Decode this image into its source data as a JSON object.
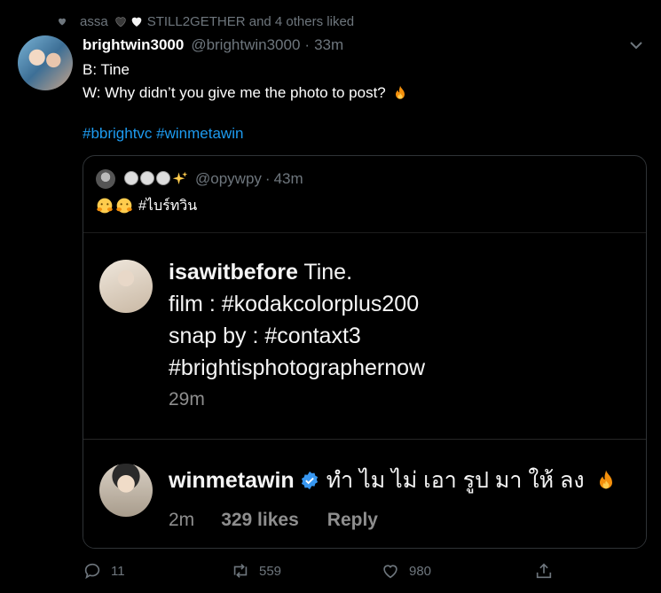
{
  "social_context": {
    "liker": "assa",
    "text": "STILL2GETHER and 4 others liked"
  },
  "tweet": {
    "display_name": "brightwin3000",
    "handle": "@brightwin3000",
    "separator": "·",
    "time": "33m",
    "line1": "B: Tine",
    "line2": "W: Why didn’t you give me the photo to post?",
    "hashtag1": "#bbrightvc",
    "hashtag2": "#winmetawin"
  },
  "quote": {
    "handle": "@opywpy",
    "separator": "·",
    "time": "43m",
    "text": "#ไบร์ทวิน"
  },
  "instagram": {
    "caption_user": "isawitbefore",
    "caption_rest": "Tine.",
    "caption_line2": "film : #kodakcolorplus200",
    "caption_line3": "snap by : #contaxt3",
    "caption_line4": "#brightisphotographernow",
    "caption_time": "29m",
    "comment_user": "winmetawin",
    "comment_text": "ทำ ไม ไม่ เอา รูป มา ให้ ลง",
    "comment_time": "2m",
    "comment_likes": "329 likes",
    "comment_reply": "Reply"
  },
  "actions": {
    "reply_count": "11",
    "retweet_count": "559",
    "like_count": "980"
  },
  "colors": {
    "link": "#1d9bf0",
    "muted": "#6e767d",
    "background": "#000000"
  },
  "icons": [
    "heart-icon",
    "black-heart-icon",
    "white-heart-icon",
    "chevron-down-icon",
    "fire-icon",
    "hugging-face-icon",
    "sparkles-icon",
    "verified-badge-icon",
    "reply-icon",
    "retweet-icon",
    "like-icon",
    "share-icon"
  ]
}
